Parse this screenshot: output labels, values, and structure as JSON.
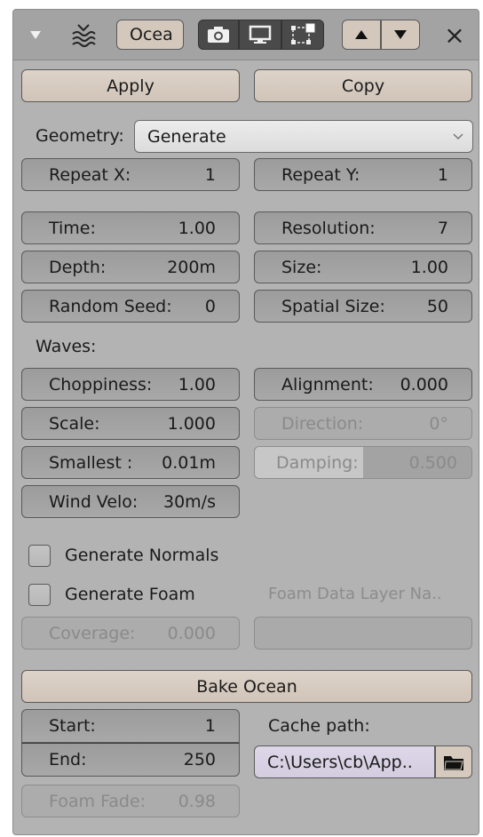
{
  "header": {
    "name_field": "Ocea",
    "close_symbol": "×"
  },
  "actions": {
    "apply": "Apply",
    "copy": "Copy"
  },
  "geometry": {
    "label": "Geometry:",
    "value": "Generate"
  },
  "repeat": {
    "x_label": "Repeat X:",
    "x_value": "1",
    "y_label": "Repeat Y:",
    "y_value": "1"
  },
  "params": {
    "time_label": "Time:",
    "time_value": "1.00",
    "resolution_label": "Resolution:",
    "resolution_value": "7",
    "depth_label": "Depth:",
    "depth_value": "200m",
    "size_label": "Size:",
    "size_value": "1.00",
    "seed_label": "Random Seed:",
    "seed_value": "0",
    "spatial_label": "Spatial Size:",
    "spatial_value": "50"
  },
  "waves": {
    "heading": "Waves:",
    "choppiness_label": "Choppiness:",
    "choppiness_value": "1.00",
    "alignment_label": "Alignment:",
    "alignment_value": "0.000",
    "scale_label": "Scale:",
    "scale_value": "1.000",
    "direction_label": "Direction:",
    "direction_value": "0°",
    "smallest_label": "Smallest :",
    "smallest_value": "0.01m",
    "damping_label": "Damping:",
    "damping_value": "0.500",
    "damping_fraction": 0.5,
    "wind_label": "Wind Velo:",
    "wind_value": "30m/s"
  },
  "options": {
    "normals_label": "Generate Normals",
    "normals_checked": false,
    "foam_label": "Generate Foam",
    "foam_checked": false,
    "foam_layer_placeholder": "Foam Data Layer Na..",
    "coverage_label": "Coverage:",
    "coverage_value": "0.000",
    "foam_layer_value": ""
  },
  "bake": {
    "button": "Bake Ocean",
    "start_label": "Start:",
    "start_value": "1",
    "end_label": "End:",
    "end_value": "250",
    "cache_label": "Cache path:",
    "cache_value": "C:\\Users\\cb\\App..",
    "foam_fade_label": "Foam Fade:",
    "foam_fade_value": "0.98"
  },
  "colors": {
    "panel_bg": "#b3b3b3",
    "action_button": "#d6cabe",
    "field_bg": "#a1a1a1",
    "toggle_active": "#4a4a4a",
    "disabled_text": "#8c8c8c"
  }
}
